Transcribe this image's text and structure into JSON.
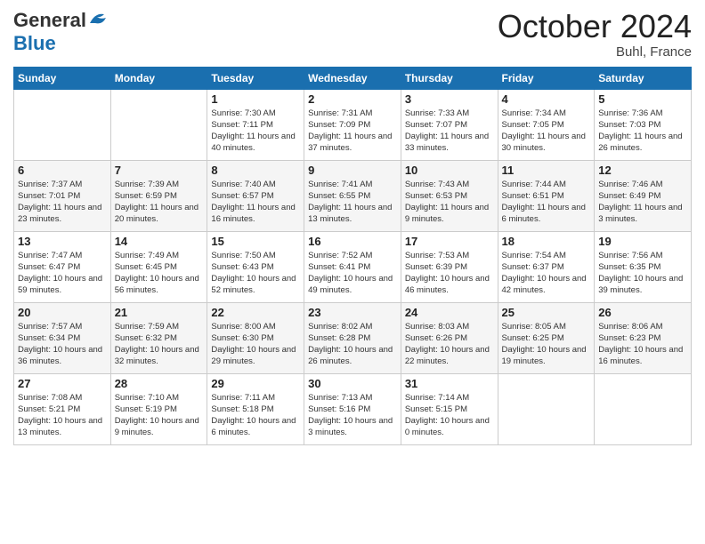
{
  "logo": {
    "general": "General",
    "blue": "Blue",
    "tagline": ""
  },
  "header": {
    "month": "October 2024",
    "location": "Buhl, France"
  },
  "days_of_week": [
    "Sunday",
    "Monday",
    "Tuesday",
    "Wednesday",
    "Thursday",
    "Friday",
    "Saturday"
  ],
  "weeks": [
    [
      {
        "day": "",
        "info": ""
      },
      {
        "day": "",
        "info": ""
      },
      {
        "day": "1",
        "info": "Sunrise: 7:30 AM\nSunset: 7:11 PM\nDaylight: 11 hours and 40 minutes."
      },
      {
        "day": "2",
        "info": "Sunrise: 7:31 AM\nSunset: 7:09 PM\nDaylight: 11 hours and 37 minutes."
      },
      {
        "day": "3",
        "info": "Sunrise: 7:33 AM\nSunset: 7:07 PM\nDaylight: 11 hours and 33 minutes."
      },
      {
        "day": "4",
        "info": "Sunrise: 7:34 AM\nSunset: 7:05 PM\nDaylight: 11 hours and 30 minutes."
      },
      {
        "day": "5",
        "info": "Sunrise: 7:36 AM\nSunset: 7:03 PM\nDaylight: 11 hours and 26 minutes."
      }
    ],
    [
      {
        "day": "6",
        "info": "Sunrise: 7:37 AM\nSunset: 7:01 PM\nDaylight: 11 hours and 23 minutes."
      },
      {
        "day": "7",
        "info": "Sunrise: 7:39 AM\nSunset: 6:59 PM\nDaylight: 11 hours and 20 minutes."
      },
      {
        "day": "8",
        "info": "Sunrise: 7:40 AM\nSunset: 6:57 PM\nDaylight: 11 hours and 16 minutes."
      },
      {
        "day": "9",
        "info": "Sunrise: 7:41 AM\nSunset: 6:55 PM\nDaylight: 11 hours and 13 minutes."
      },
      {
        "day": "10",
        "info": "Sunrise: 7:43 AM\nSunset: 6:53 PM\nDaylight: 11 hours and 9 minutes."
      },
      {
        "day": "11",
        "info": "Sunrise: 7:44 AM\nSunset: 6:51 PM\nDaylight: 11 hours and 6 minutes."
      },
      {
        "day": "12",
        "info": "Sunrise: 7:46 AM\nSunset: 6:49 PM\nDaylight: 11 hours and 3 minutes."
      }
    ],
    [
      {
        "day": "13",
        "info": "Sunrise: 7:47 AM\nSunset: 6:47 PM\nDaylight: 10 hours and 59 minutes."
      },
      {
        "day": "14",
        "info": "Sunrise: 7:49 AM\nSunset: 6:45 PM\nDaylight: 10 hours and 56 minutes."
      },
      {
        "day": "15",
        "info": "Sunrise: 7:50 AM\nSunset: 6:43 PM\nDaylight: 10 hours and 52 minutes."
      },
      {
        "day": "16",
        "info": "Sunrise: 7:52 AM\nSunset: 6:41 PM\nDaylight: 10 hours and 49 minutes."
      },
      {
        "day": "17",
        "info": "Sunrise: 7:53 AM\nSunset: 6:39 PM\nDaylight: 10 hours and 46 minutes."
      },
      {
        "day": "18",
        "info": "Sunrise: 7:54 AM\nSunset: 6:37 PM\nDaylight: 10 hours and 42 minutes."
      },
      {
        "day": "19",
        "info": "Sunrise: 7:56 AM\nSunset: 6:35 PM\nDaylight: 10 hours and 39 minutes."
      }
    ],
    [
      {
        "day": "20",
        "info": "Sunrise: 7:57 AM\nSunset: 6:34 PM\nDaylight: 10 hours and 36 minutes."
      },
      {
        "day": "21",
        "info": "Sunrise: 7:59 AM\nSunset: 6:32 PM\nDaylight: 10 hours and 32 minutes."
      },
      {
        "day": "22",
        "info": "Sunrise: 8:00 AM\nSunset: 6:30 PM\nDaylight: 10 hours and 29 minutes."
      },
      {
        "day": "23",
        "info": "Sunrise: 8:02 AM\nSunset: 6:28 PM\nDaylight: 10 hours and 26 minutes."
      },
      {
        "day": "24",
        "info": "Sunrise: 8:03 AM\nSunset: 6:26 PM\nDaylight: 10 hours and 22 minutes."
      },
      {
        "day": "25",
        "info": "Sunrise: 8:05 AM\nSunset: 6:25 PM\nDaylight: 10 hours and 19 minutes."
      },
      {
        "day": "26",
        "info": "Sunrise: 8:06 AM\nSunset: 6:23 PM\nDaylight: 10 hours and 16 minutes."
      }
    ],
    [
      {
        "day": "27",
        "info": "Sunrise: 7:08 AM\nSunset: 5:21 PM\nDaylight: 10 hours and 13 minutes."
      },
      {
        "day": "28",
        "info": "Sunrise: 7:10 AM\nSunset: 5:19 PM\nDaylight: 10 hours and 9 minutes."
      },
      {
        "day": "29",
        "info": "Sunrise: 7:11 AM\nSunset: 5:18 PM\nDaylight: 10 hours and 6 minutes."
      },
      {
        "day": "30",
        "info": "Sunrise: 7:13 AM\nSunset: 5:16 PM\nDaylight: 10 hours and 3 minutes."
      },
      {
        "day": "31",
        "info": "Sunrise: 7:14 AM\nSunset: 5:15 PM\nDaylight: 10 hours and 0 minutes."
      },
      {
        "day": "",
        "info": ""
      },
      {
        "day": "",
        "info": ""
      }
    ]
  ]
}
